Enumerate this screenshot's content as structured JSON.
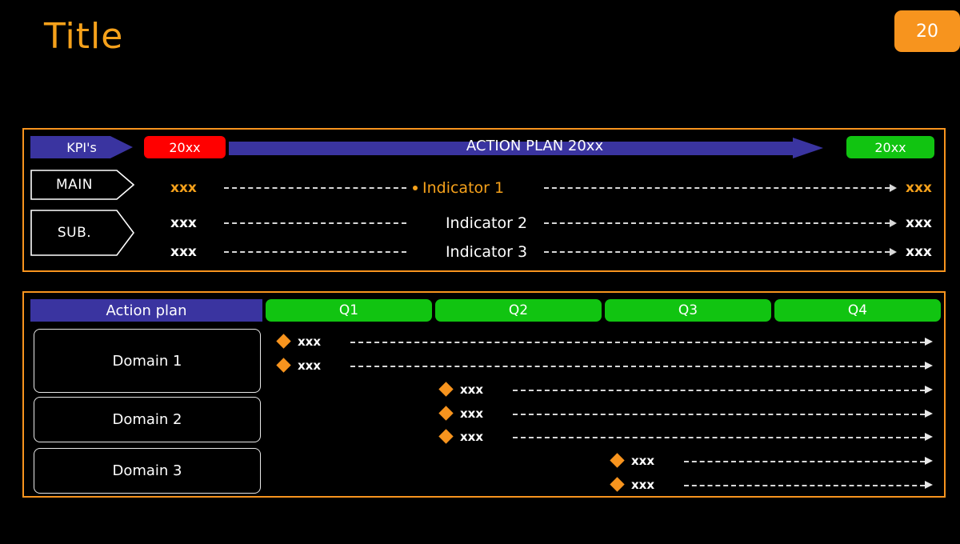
{
  "slide": {
    "title": "Title",
    "page_number": "20"
  },
  "colors": {
    "accent_orange": "#F7941E",
    "title_orange": "#F5A11B",
    "blue": "#3A34A0",
    "red": "#FF0000",
    "green": "#11C411",
    "background": "#000000",
    "line_grey": "#d8d8d8"
  },
  "kpi_section": {
    "tag_label": "KPI's",
    "start_year_label": "20xx",
    "action_plan_label": "ACTION PLAN 20xx",
    "end_year_label": "20xx",
    "category_labels": [
      {
        "name": "main",
        "label": "MAIN"
      },
      {
        "name": "sub",
        "label": "SUB."
      }
    ],
    "rows": [
      {
        "left_value": "xxx",
        "indicator": "Indicator 1",
        "right_value": "xxx",
        "highlighted": true
      },
      {
        "left_value": "xxx",
        "indicator": "Indicator 2",
        "right_value": "xxx",
        "highlighted": false
      },
      {
        "left_value": "xxx",
        "indicator": "Indicator 3",
        "right_value": "xxx",
        "highlighted": false
      }
    ]
  },
  "plan_section": {
    "tag_label": "Action plan",
    "quarters": [
      "Q1",
      "Q2",
      "Q3",
      "Q4"
    ],
    "domains": [
      {
        "label": "Domain 1"
      },
      {
        "label": "Domain 2"
      },
      {
        "label": "Domain 3"
      }
    ],
    "tasks": [
      {
        "label": "xxx"
      },
      {
        "label": "xxx"
      },
      {
        "label": "xxx"
      },
      {
        "label": "xxx"
      },
      {
        "label": "xxx"
      },
      {
        "label": "xxx"
      },
      {
        "label": "xxx"
      }
    ]
  }
}
